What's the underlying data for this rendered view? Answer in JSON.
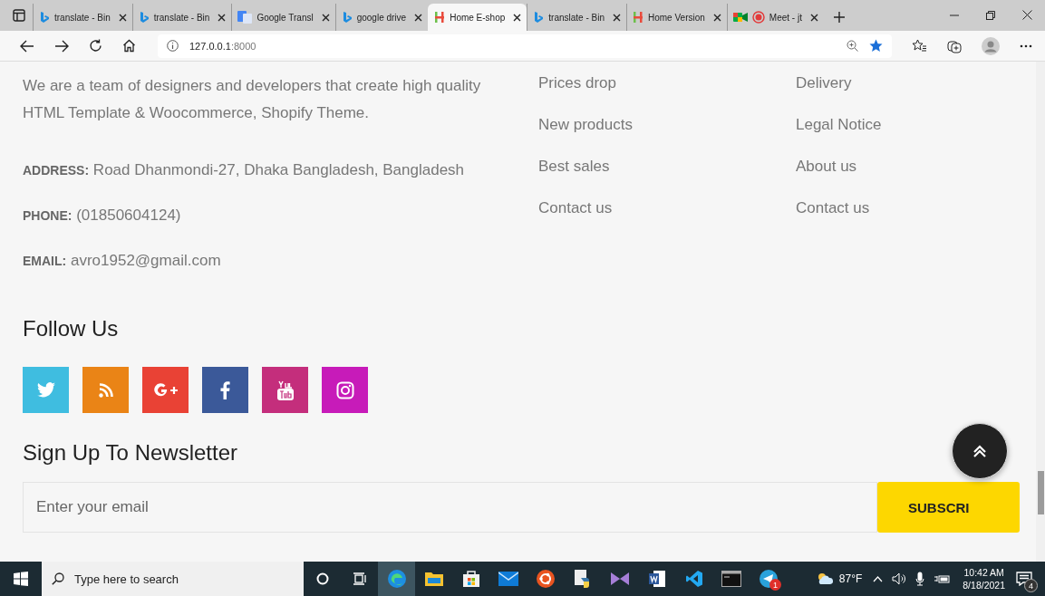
{
  "browser": {
    "tabs": [
      {
        "kind": "bing",
        "title": "translate - Bin",
        "selected": false
      },
      {
        "kind": "bing",
        "title": "translate - Bin",
        "selected": false
      },
      {
        "kind": "gtranslate",
        "title": "Google Transl",
        "selected": false
      },
      {
        "kind": "bing",
        "title": "google drive",
        "selected": false
      },
      {
        "kind": "hlogo",
        "title": "Home E-shop",
        "selected": true
      },
      {
        "kind": "bing",
        "title": "translate - Bin",
        "selected": false
      },
      {
        "kind": "hlogo",
        "title": "Home Version",
        "selected": false
      },
      {
        "kind": "meet",
        "title": "Meet - jt",
        "selected": false
      }
    ],
    "address": {
      "host": "127.0.0.1",
      "port": ":8000"
    }
  },
  "footer": {
    "about": "We are a team of designers and developers that create high quality HTML Template & Woocommerce, Shopify Theme.",
    "contacts": [
      {
        "label": "ADDRESS:",
        "value": "Road Dhanmondi-27, Dhaka Bangladesh, Bangladesh"
      },
      {
        "label": "PHONE:",
        "value": "(01850604124)"
      },
      {
        "label": "EMAIL:",
        "value": "avro1952@gmail.com"
      }
    ],
    "links_1": [
      "Prices drop",
      "New products",
      "Best sales",
      "Contact us"
    ],
    "links_2": [
      "Delivery",
      "Legal Notice",
      "About us",
      "Contact us"
    ],
    "follow_heading": "Follow Us",
    "social": [
      {
        "kind": "twitter",
        "color": "#3fbde0"
      },
      {
        "kind": "rss",
        "color": "#ea8416"
      },
      {
        "kind": "gplus",
        "color": "#e94235"
      },
      {
        "kind": "facebook",
        "color": "#3b5999"
      },
      {
        "kind": "youtube",
        "color": "#c42e7c"
      },
      {
        "kind": "instagram",
        "color": "#c71bb9"
      }
    ],
    "newsletter_heading": "Sign Up To Newsletter",
    "email_placeholder": "Enter your email",
    "subscribe": "SUBSCRI"
  },
  "taskbar": {
    "search_placeholder": "Type here to search",
    "telegram_badge": "1",
    "temperature": "87°F",
    "time": "10:42 AM",
    "date": "8/18/2021",
    "notifications": "4"
  }
}
